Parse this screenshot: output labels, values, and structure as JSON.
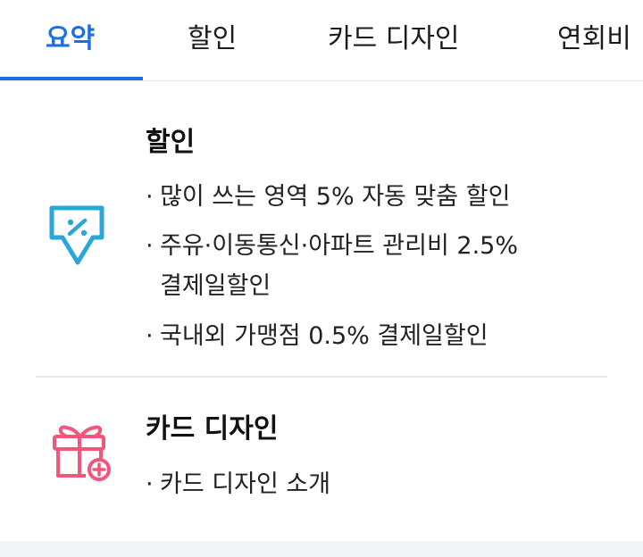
{
  "tabs": [
    {
      "label": "요약"
    },
    {
      "label": "할인"
    },
    {
      "label": "카드 디자인"
    },
    {
      "label": "연회비"
    }
  ],
  "discount": {
    "title": "할인",
    "icon": "discount-tag-icon",
    "items": [
      "많이 쓰는 영역 5% 자동 맞춤 할인",
      "주유·이동통신·아파트 관리비 2.5%",
      "결제일할인",
      "국내외 가맹점 0.5% 결제일할인"
    ]
  },
  "card_design": {
    "title": "카드 디자인",
    "icon": "gift-icon",
    "items": [
      "카드 디자인 소개"
    ]
  },
  "colors": {
    "accent": "#1e6fe0",
    "discount_icon": "#2aa7d6",
    "gift_icon": "#f2577b"
  }
}
